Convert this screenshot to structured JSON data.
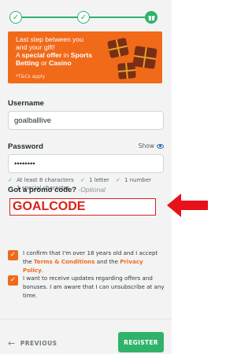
{
  "stepper": {
    "step1": "✓",
    "step2": "✓",
    "step3_icon": "gift-icon"
  },
  "banner": {
    "line1": "Last step between you",
    "line2": "and your gift!",
    "line3_pre": "A ",
    "line3_bold": "special offer",
    "line3_mid": " in ",
    "line3_bold2": "Sports",
    "line4_bold": "Betting",
    "line4_mid": " or ",
    "line4_bold2": "Casino",
    "terms": "*T&Cs apply"
  },
  "username": {
    "label": "Username",
    "value": "goalballlive"
  },
  "password": {
    "label": "Password",
    "value": "••••••••",
    "show_label": "Show",
    "rules": [
      "At least 8 characters",
      "1 letter",
      "1 number",
      "1 special character"
    ]
  },
  "promo": {
    "label": "Got a promo code?",
    "optional": " -Optional",
    "value": "GOALCODE"
  },
  "consent": {
    "age_pre": "I confirm that I'm over 18 years old and I accept the ",
    "terms_link": "Terms & Conditions",
    "and": " and the ",
    "privacy_link": "Privacy Policy",
    "end": ".",
    "marketing": "I want to receive updates regarding offers and bonuses. I am aware that I can unsubscribe at any time."
  },
  "footer": {
    "previous": "PREVIOUS",
    "register": "REGISTER"
  },
  "colors": {
    "accent": "#f06a1a",
    "success": "#2fb36a",
    "annotation": "#e8111a"
  }
}
